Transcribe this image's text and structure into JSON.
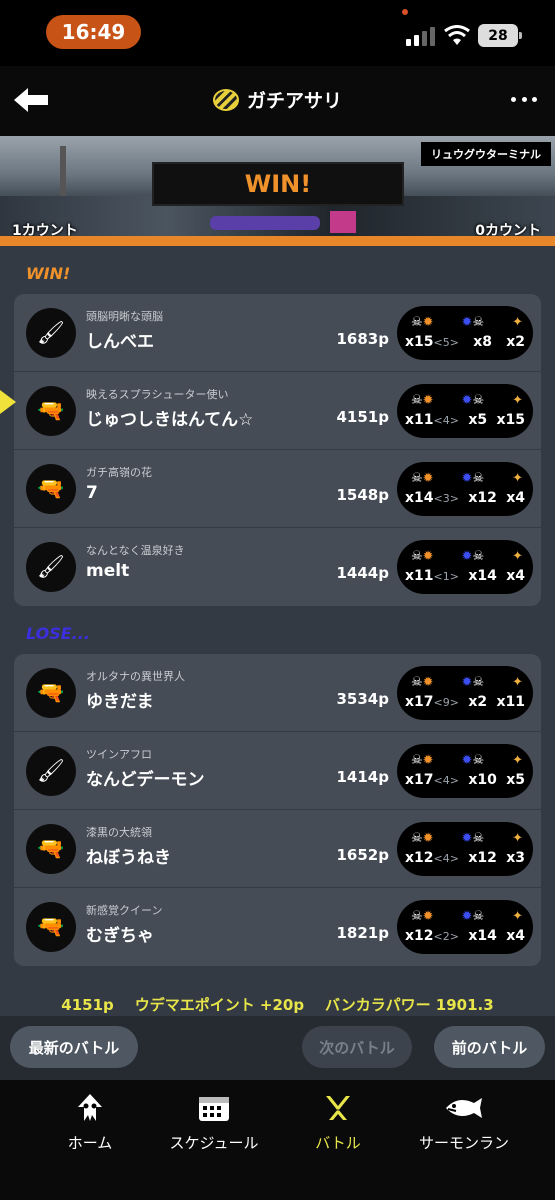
{
  "status_bar": {
    "time": "16:49",
    "battery": "28"
  },
  "header": {
    "title": "ガチアサリ"
  },
  "stage": {
    "name": "リュウグウターミナル",
    "result": "WIN!",
    "count_left": "1カウント",
    "count_right": "0カウント"
  },
  "teams": {
    "win_label": "WIN!",
    "lose_label": "LOSE...",
    "win_players": [
      {
        "title": "頭脳明晰な頭脳",
        "name": "しんべエ",
        "paint": "1683p",
        "kills": "x15",
        "assists": "<5>",
        "deaths": "x8",
        "specials": "x2",
        "weapon_icon": "🖌"
      },
      {
        "title": "映えるスプラシューター使い",
        "name": "じゅつしきはんてん☆",
        "paint": "4151p",
        "kills": "x11",
        "assists": "<4>",
        "deaths": "x5",
        "specials": "x15",
        "weapon_icon": "🔫"
      },
      {
        "title": "ガチ高嶺の花",
        "name": "7",
        "paint": "1548p",
        "kills": "x14",
        "assists": "<3>",
        "deaths": "x12",
        "specials": "x4",
        "weapon_icon": "🔫"
      },
      {
        "title": "なんとなく温泉好き",
        "name": "melt",
        "paint": "1444p",
        "kills": "x11",
        "assists": "<1>",
        "deaths": "x14",
        "specials": "x4",
        "weapon_icon": "🖌"
      }
    ],
    "lose_players": [
      {
        "title": "オルタナの異世界人",
        "name": "ゆきだま",
        "paint": "3534p",
        "kills": "x17",
        "assists": "<9>",
        "deaths": "x2",
        "specials": "x11",
        "weapon_icon": "🔫"
      },
      {
        "title": "ツインアフロ",
        "name": "なんどデーモン",
        "paint": "1414p",
        "kills": "x17",
        "assists": "<4>",
        "deaths": "x10",
        "specials": "x5",
        "weapon_icon": "🖌"
      },
      {
        "title": "漆黒の大統領",
        "name": "ねぼうねき",
        "paint": "1652p",
        "kills": "x12",
        "assists": "<4>",
        "deaths": "x12",
        "specials": "x3",
        "weapon_icon": "🔫"
      },
      {
        "title": "新感覚クイーン",
        "name": "むぎちゃ",
        "paint": "1821p",
        "kills": "x12",
        "assists": "<2>",
        "deaths": "x14",
        "specials": "x4",
        "weapon_icon": "🔫"
      }
    ]
  },
  "summary": {
    "paint": "4151p",
    "udemae": "ウデマエポイント +20p",
    "bankara": "バンカラパワー 1901.3"
  },
  "battle_nav": {
    "latest": "最新のバトル",
    "next": "次のバトル",
    "prev": "前のバトル"
  },
  "tabs": [
    {
      "label": "ホーム"
    },
    {
      "label": "スケジュール"
    },
    {
      "label": "バトル"
    },
    {
      "label": "サーモンラン"
    }
  ],
  "colors": {
    "accent_orange": "#f0922b",
    "lose_blue": "#3b2fe0",
    "highlight_yellow": "#e8e54a"
  }
}
